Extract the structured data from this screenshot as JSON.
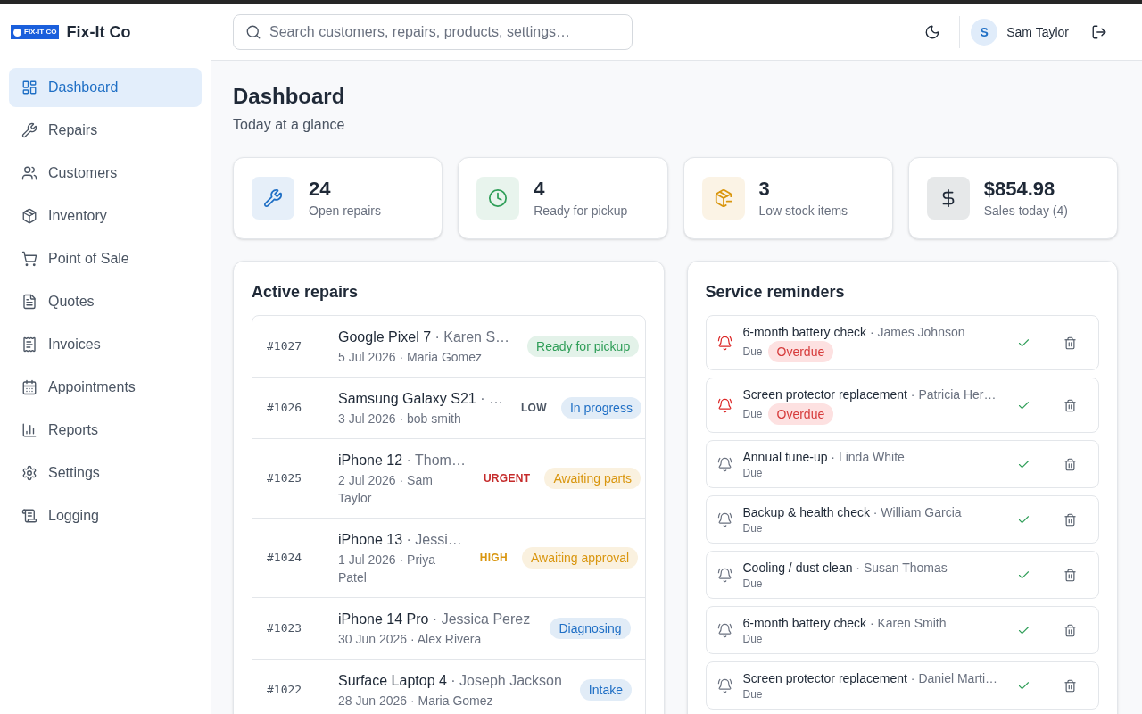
{
  "brand": {
    "logo_text": "FIX-IT CO",
    "name": "Fix-It Co"
  },
  "sidebar": {
    "items": [
      {
        "label": "Dashboard",
        "selected": true
      },
      {
        "label": "Repairs",
        "selected": false
      },
      {
        "label": "Customers",
        "selected": false
      },
      {
        "label": "Inventory",
        "selected": false
      },
      {
        "label": "Point of Sale",
        "selected": false
      },
      {
        "label": "Quotes",
        "selected": false
      },
      {
        "label": "Invoices",
        "selected": false
      },
      {
        "label": "Appointments",
        "selected": false
      },
      {
        "label": "Reports",
        "selected": false
      },
      {
        "label": "Settings",
        "selected": false
      },
      {
        "label": "Logging",
        "selected": false
      }
    ]
  },
  "header": {
    "search": {
      "placeholder": "Search customers, repairs, products, settings…"
    },
    "user": {
      "initial": "S",
      "name": "Sam Taylor"
    }
  },
  "page": {
    "title": "Dashboard",
    "subtitle": "Today at a glance"
  },
  "stats": [
    {
      "value": "24",
      "label": "Open repairs",
      "color": "#1f6fc5"
    },
    {
      "value": "4",
      "label": "Ready for pickup",
      "color": "#2f9e58"
    },
    {
      "value": "3",
      "label": "Low stock items",
      "color": "#d9960f"
    },
    {
      "value": "$854.98",
      "label": "Sales today (4)",
      "color": "#1f2937"
    }
  ],
  "active_repairs": {
    "title": "Active repairs",
    "rows": [
      {
        "id": "#1027",
        "device": "Google Pixel 7",
        "customer": "· Karen S…",
        "meta": "5 Jul 2026 · Maria Gomez",
        "status": {
          "label": "Ready for pickup",
          "color": "#2f9e58"
        }
      },
      {
        "id": "#1026",
        "device": "Samsung Galaxy S21",
        "customer": "· …",
        "meta": "3 Jul 2026 · bob smith",
        "priority": {
          "label": "LOW",
          "color": "#4b5563"
        },
        "status": {
          "label": "In progress",
          "color": "#1f6fc5"
        }
      },
      {
        "id": "#1025",
        "device": "iPhone 12",
        "customer": "· Thom…",
        "meta": "2 Jul 2026 · Sam Taylor",
        "priority": {
          "label": "URGENT",
          "color": "#c52b2b"
        },
        "status": {
          "label": "Awaiting parts",
          "color": "#d9960f"
        }
      },
      {
        "id": "#1024",
        "device": "iPhone 13",
        "customer": "· Jessi…",
        "meta": "1 Jul 2026 · Priya Patel",
        "priority": {
          "label": "HIGH",
          "color": "#d9960f"
        },
        "status": {
          "label": "Awaiting approval",
          "color": "#d9960f"
        }
      },
      {
        "id": "#1023",
        "device": "iPhone 14 Pro",
        "customer": "· Jessica Perez",
        "meta": "30 Jun 2026 · Alex Rivera",
        "status": {
          "label": "Diagnosing",
          "color": "#1f6fc5"
        }
      },
      {
        "id": "#1022",
        "device": "Surface Laptop 4",
        "customer": "· Joseph Jackson",
        "meta": "28 Jun 2026 · Maria Gomez",
        "status": {
          "label": "Intake",
          "color": "#1f6fc5"
        }
      }
    ]
  },
  "service_reminders": {
    "title": "Service reminders",
    "items": [
      {
        "service": "6-month battery check",
        "customer": "· James Johnson",
        "due": "Due",
        "overdue": true,
        "badge": "Overdue"
      },
      {
        "service": "Screen protector replacement",
        "customer": "· Patricia Her…",
        "due": "Due",
        "overdue": true,
        "badge": "Overdue"
      },
      {
        "service": "Annual tune-up",
        "customer": "· Linda White",
        "due": "Due",
        "overdue": false
      },
      {
        "service": "Backup & health check",
        "customer": "· William Garcia",
        "due": "Due",
        "overdue": false
      },
      {
        "service": "Cooling / dust clean",
        "customer": "· Susan Thomas",
        "due": "Due",
        "overdue": false
      },
      {
        "service": "6-month battery check",
        "customer": "· Karen Smith",
        "due": "Due",
        "overdue": false
      },
      {
        "service": "Screen protector replacement",
        "customer": "· Daniel Marti…",
        "due": "Due",
        "overdue": false
      }
    ]
  }
}
